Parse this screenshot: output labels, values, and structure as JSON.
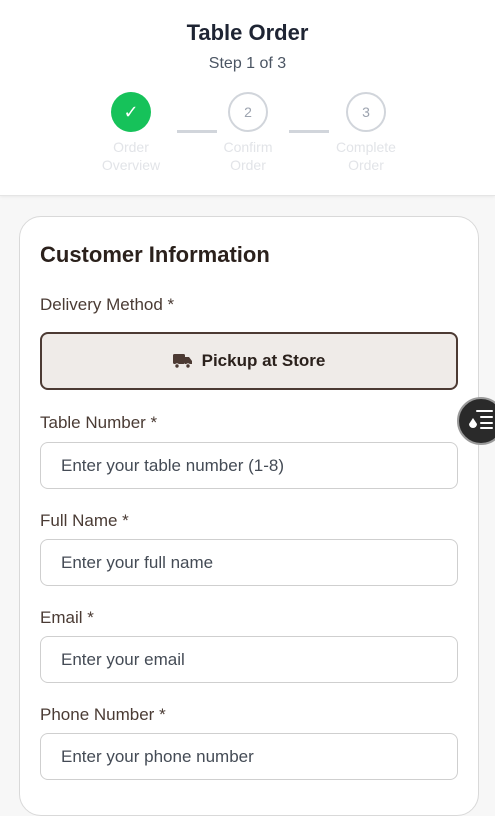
{
  "header": {
    "title": "Table Order",
    "subtitle": "Step 1 of 3",
    "steps": [
      {
        "marker": "✓",
        "label_line1": "Order",
        "label_line2": "Overview",
        "state": "complete"
      },
      {
        "marker": "2",
        "label_line1": "Confirm",
        "label_line2": "Order",
        "state": "pending"
      },
      {
        "marker": "3",
        "label_line1": "Complete",
        "label_line2": "Order",
        "state": "pending"
      }
    ]
  },
  "form": {
    "title": "Customer Information",
    "delivery_label": "Delivery Method *",
    "delivery_option": "Pickup at Store",
    "delivery_icon": "truck-icon",
    "table_label": "Table Number *",
    "table_placeholder": "Enter your table number (1-8)",
    "name_label": "Full Name *",
    "name_placeholder": "Enter your full name",
    "email_label": "Email *",
    "email_placeholder": "Enter your email",
    "phone_label": "Phone Number *",
    "phone_placeholder": "Enter your phone number"
  },
  "fab": {
    "icon": "list-filter-icon"
  },
  "colors": {
    "complete_step": "#16c25a",
    "brand_dark": "#4c3a33",
    "selected_bg": "#efebe8"
  }
}
